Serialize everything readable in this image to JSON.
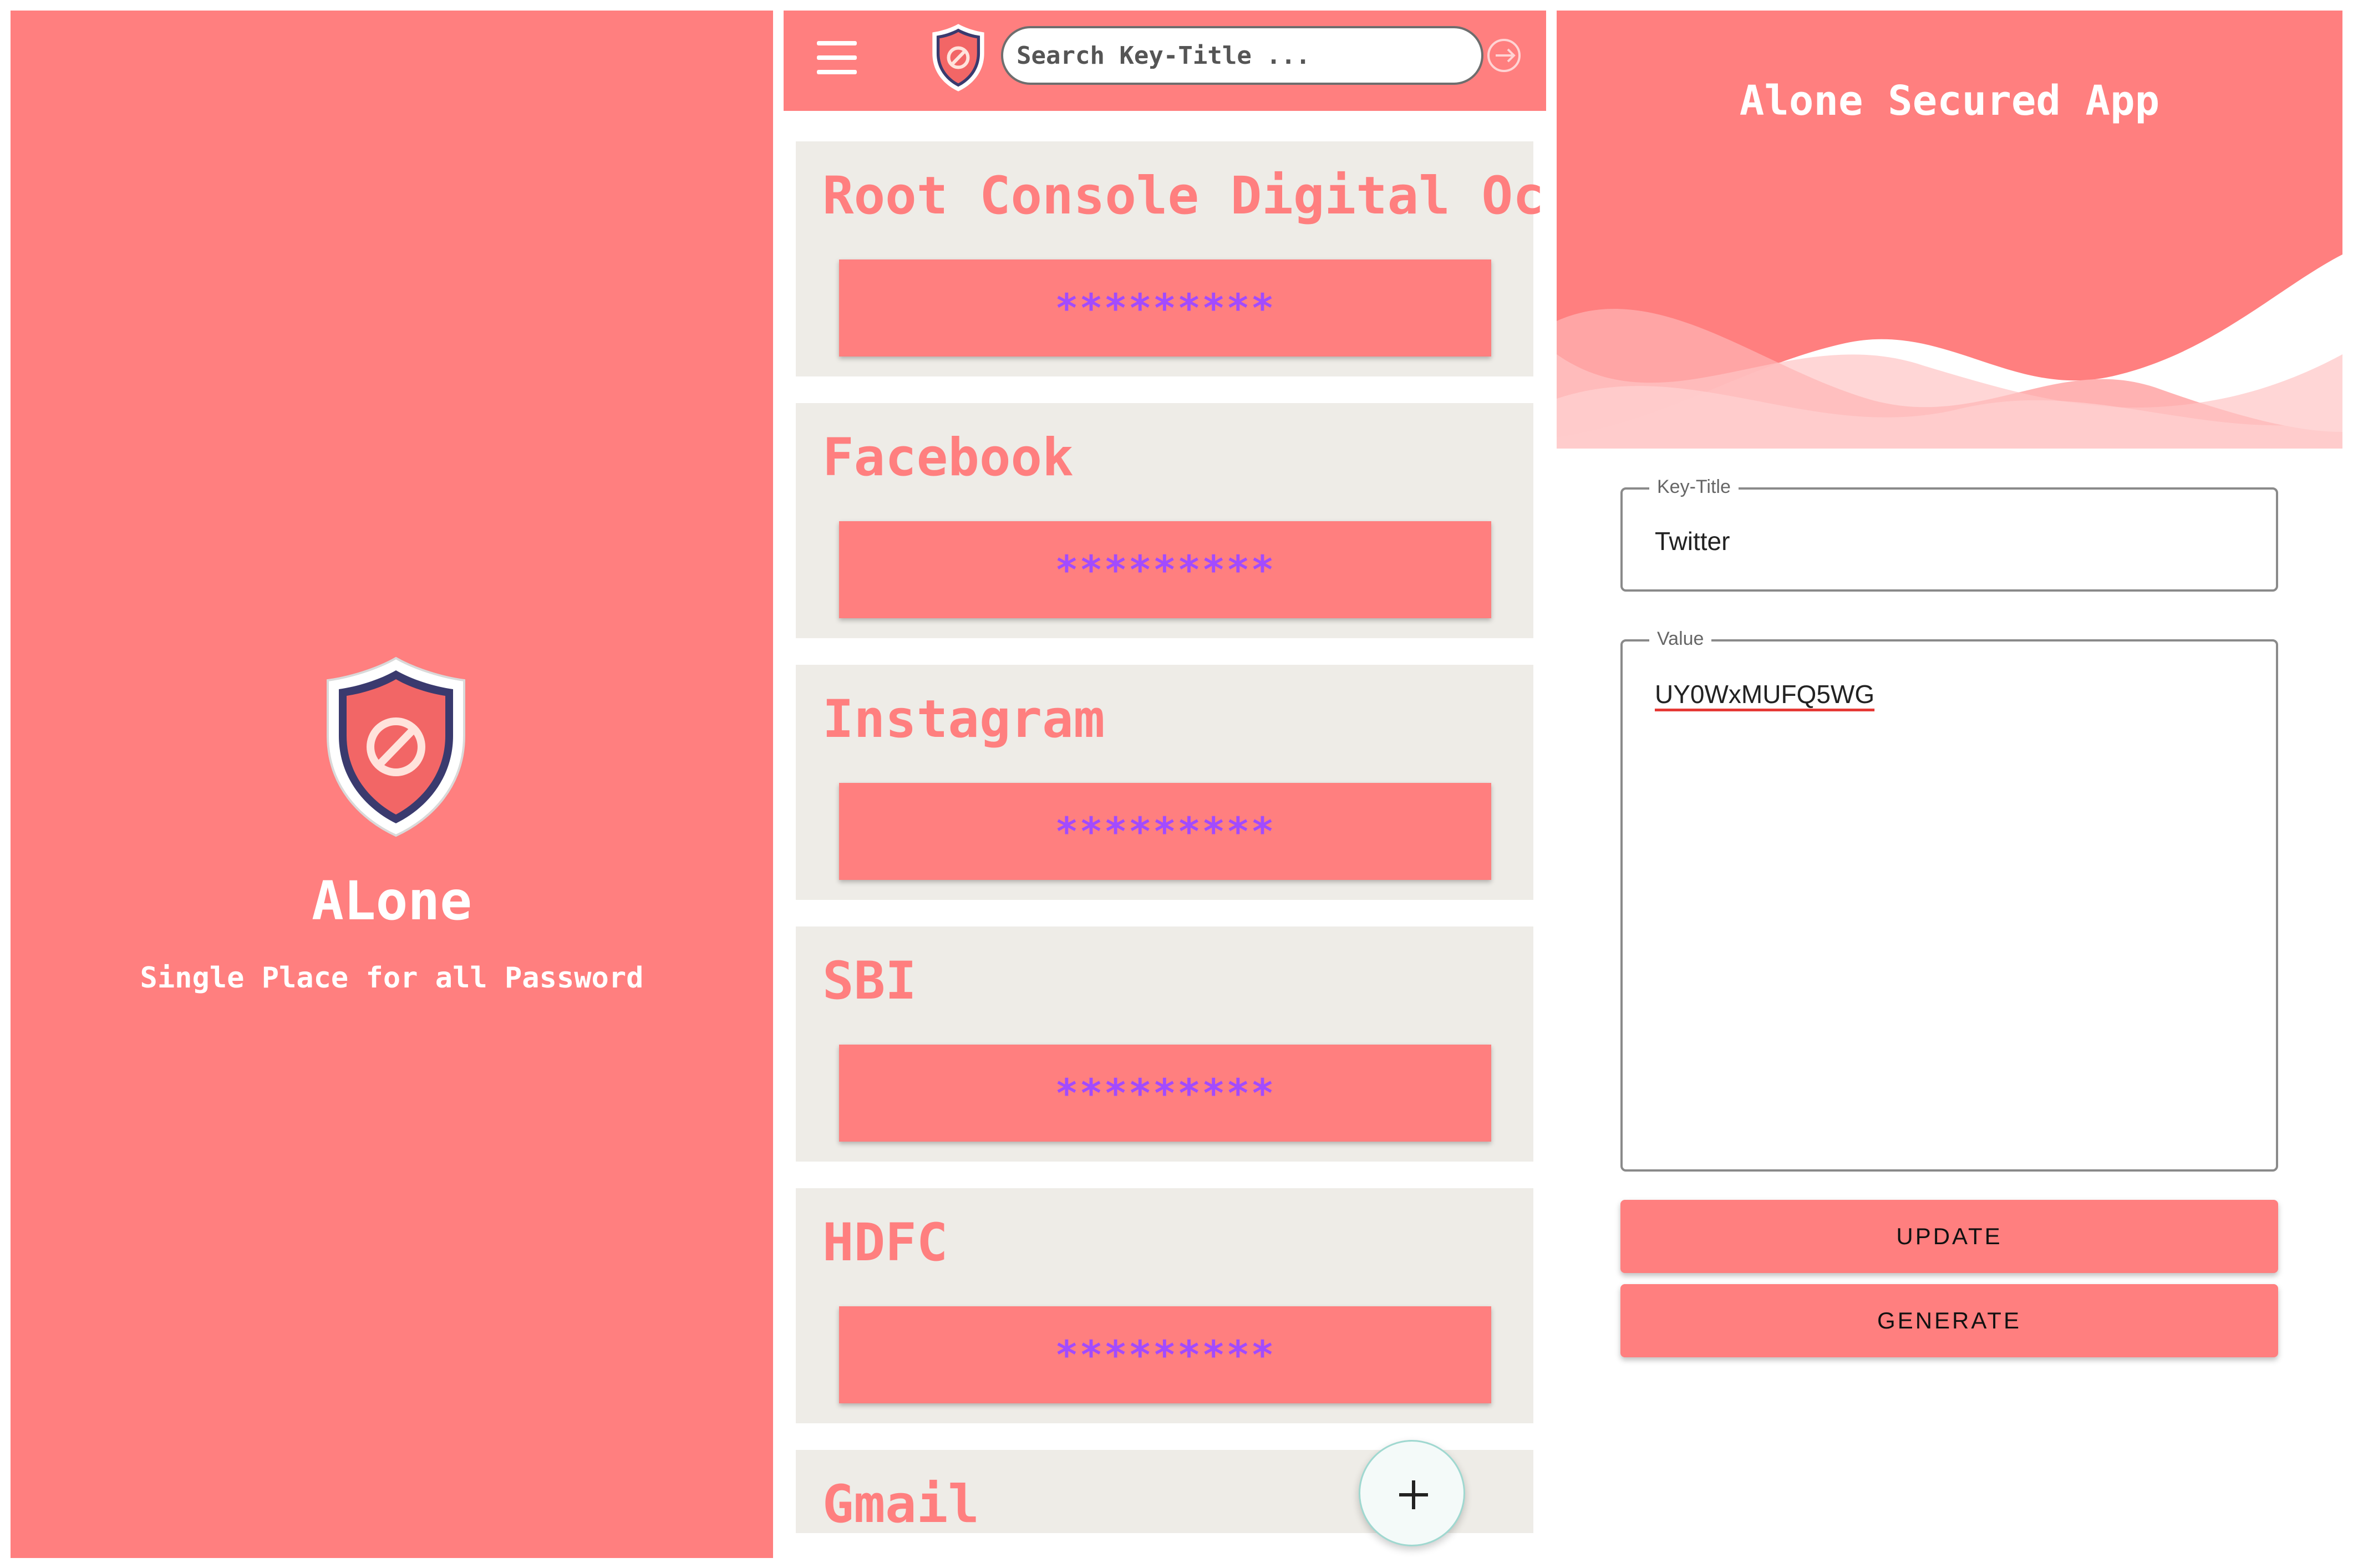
{
  "colors": {
    "accent": "#ff7f7f",
    "card_background": "#eeece7",
    "mask_text": "#a24bff",
    "logo_border": "#3a3a6e"
  },
  "splash": {
    "logo_icon": "shield-block-icon",
    "app_name": "ALone",
    "tagline": "Single Place for all Password"
  },
  "list_screen": {
    "menu_icon": "hamburger-menu-icon",
    "logo_icon": "shield-block-icon",
    "search_placeholder": "Search Key-Title ...",
    "logout_icon": "logout-arrow-icon",
    "items": [
      {
        "title": "Root Console Digital Ocean",
        "masked_value": "*********"
      },
      {
        "title": "Facebook",
        "masked_value": "*********"
      },
      {
        "title": "Instagram",
        "masked_value": "*********"
      },
      {
        "title": "SBI",
        "masked_value": "*********"
      },
      {
        "title": "HDFC",
        "masked_value": "*********"
      },
      {
        "title": "Gmail",
        "masked_value": ""
      }
    ],
    "fab_icon": "plus-icon"
  },
  "edit_screen": {
    "header_title": "Alone Secured App",
    "key_title_label": "Key-Title",
    "key_title_value": "Twitter",
    "value_label": "Value",
    "value_text": "UY0WxMUFQ5WG",
    "update_label": "UPDATE",
    "generate_label": "GENERATE"
  }
}
